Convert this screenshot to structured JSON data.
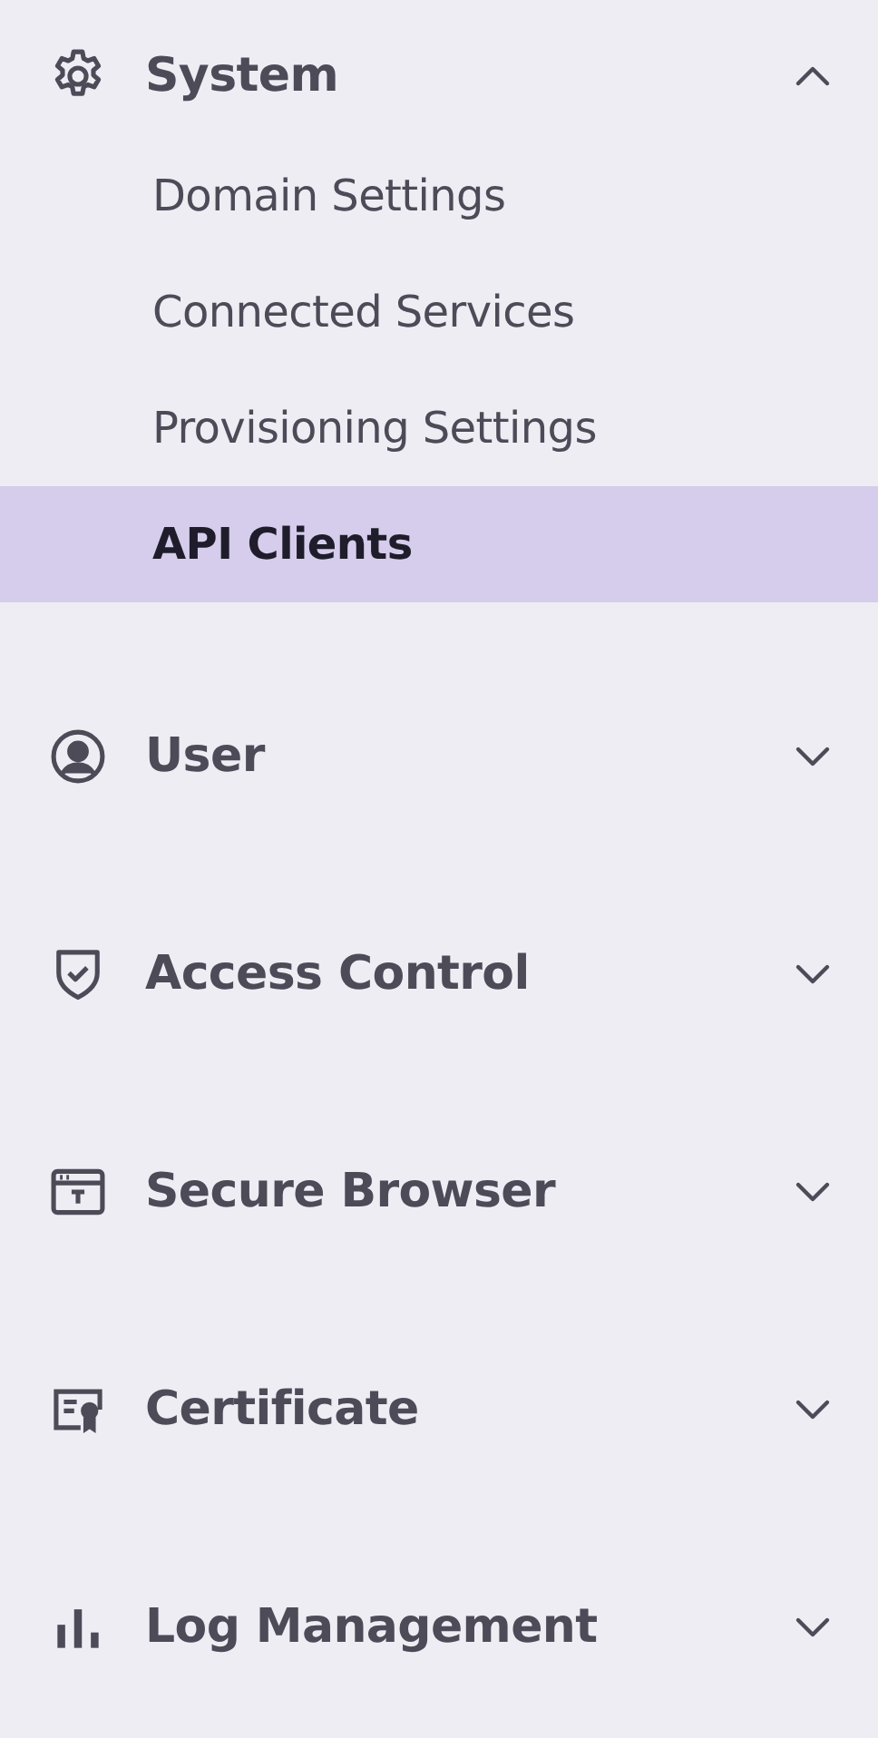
{
  "sections": [
    {
      "label": "System",
      "expanded": true,
      "items": [
        {
          "label": "Domain Settings",
          "selected": false
        },
        {
          "label": "Connected Services",
          "selected": false
        },
        {
          "label": "Provisioning Settings",
          "selected": false
        },
        {
          "label": "API Clients",
          "selected": true
        }
      ]
    },
    {
      "label": "User",
      "expanded": false
    },
    {
      "label": "Access Control",
      "expanded": false
    },
    {
      "label": "Secure Browser",
      "expanded": false
    },
    {
      "label": "Certificate",
      "expanded": false
    },
    {
      "label": "Log Management",
      "expanded": false
    }
  ]
}
